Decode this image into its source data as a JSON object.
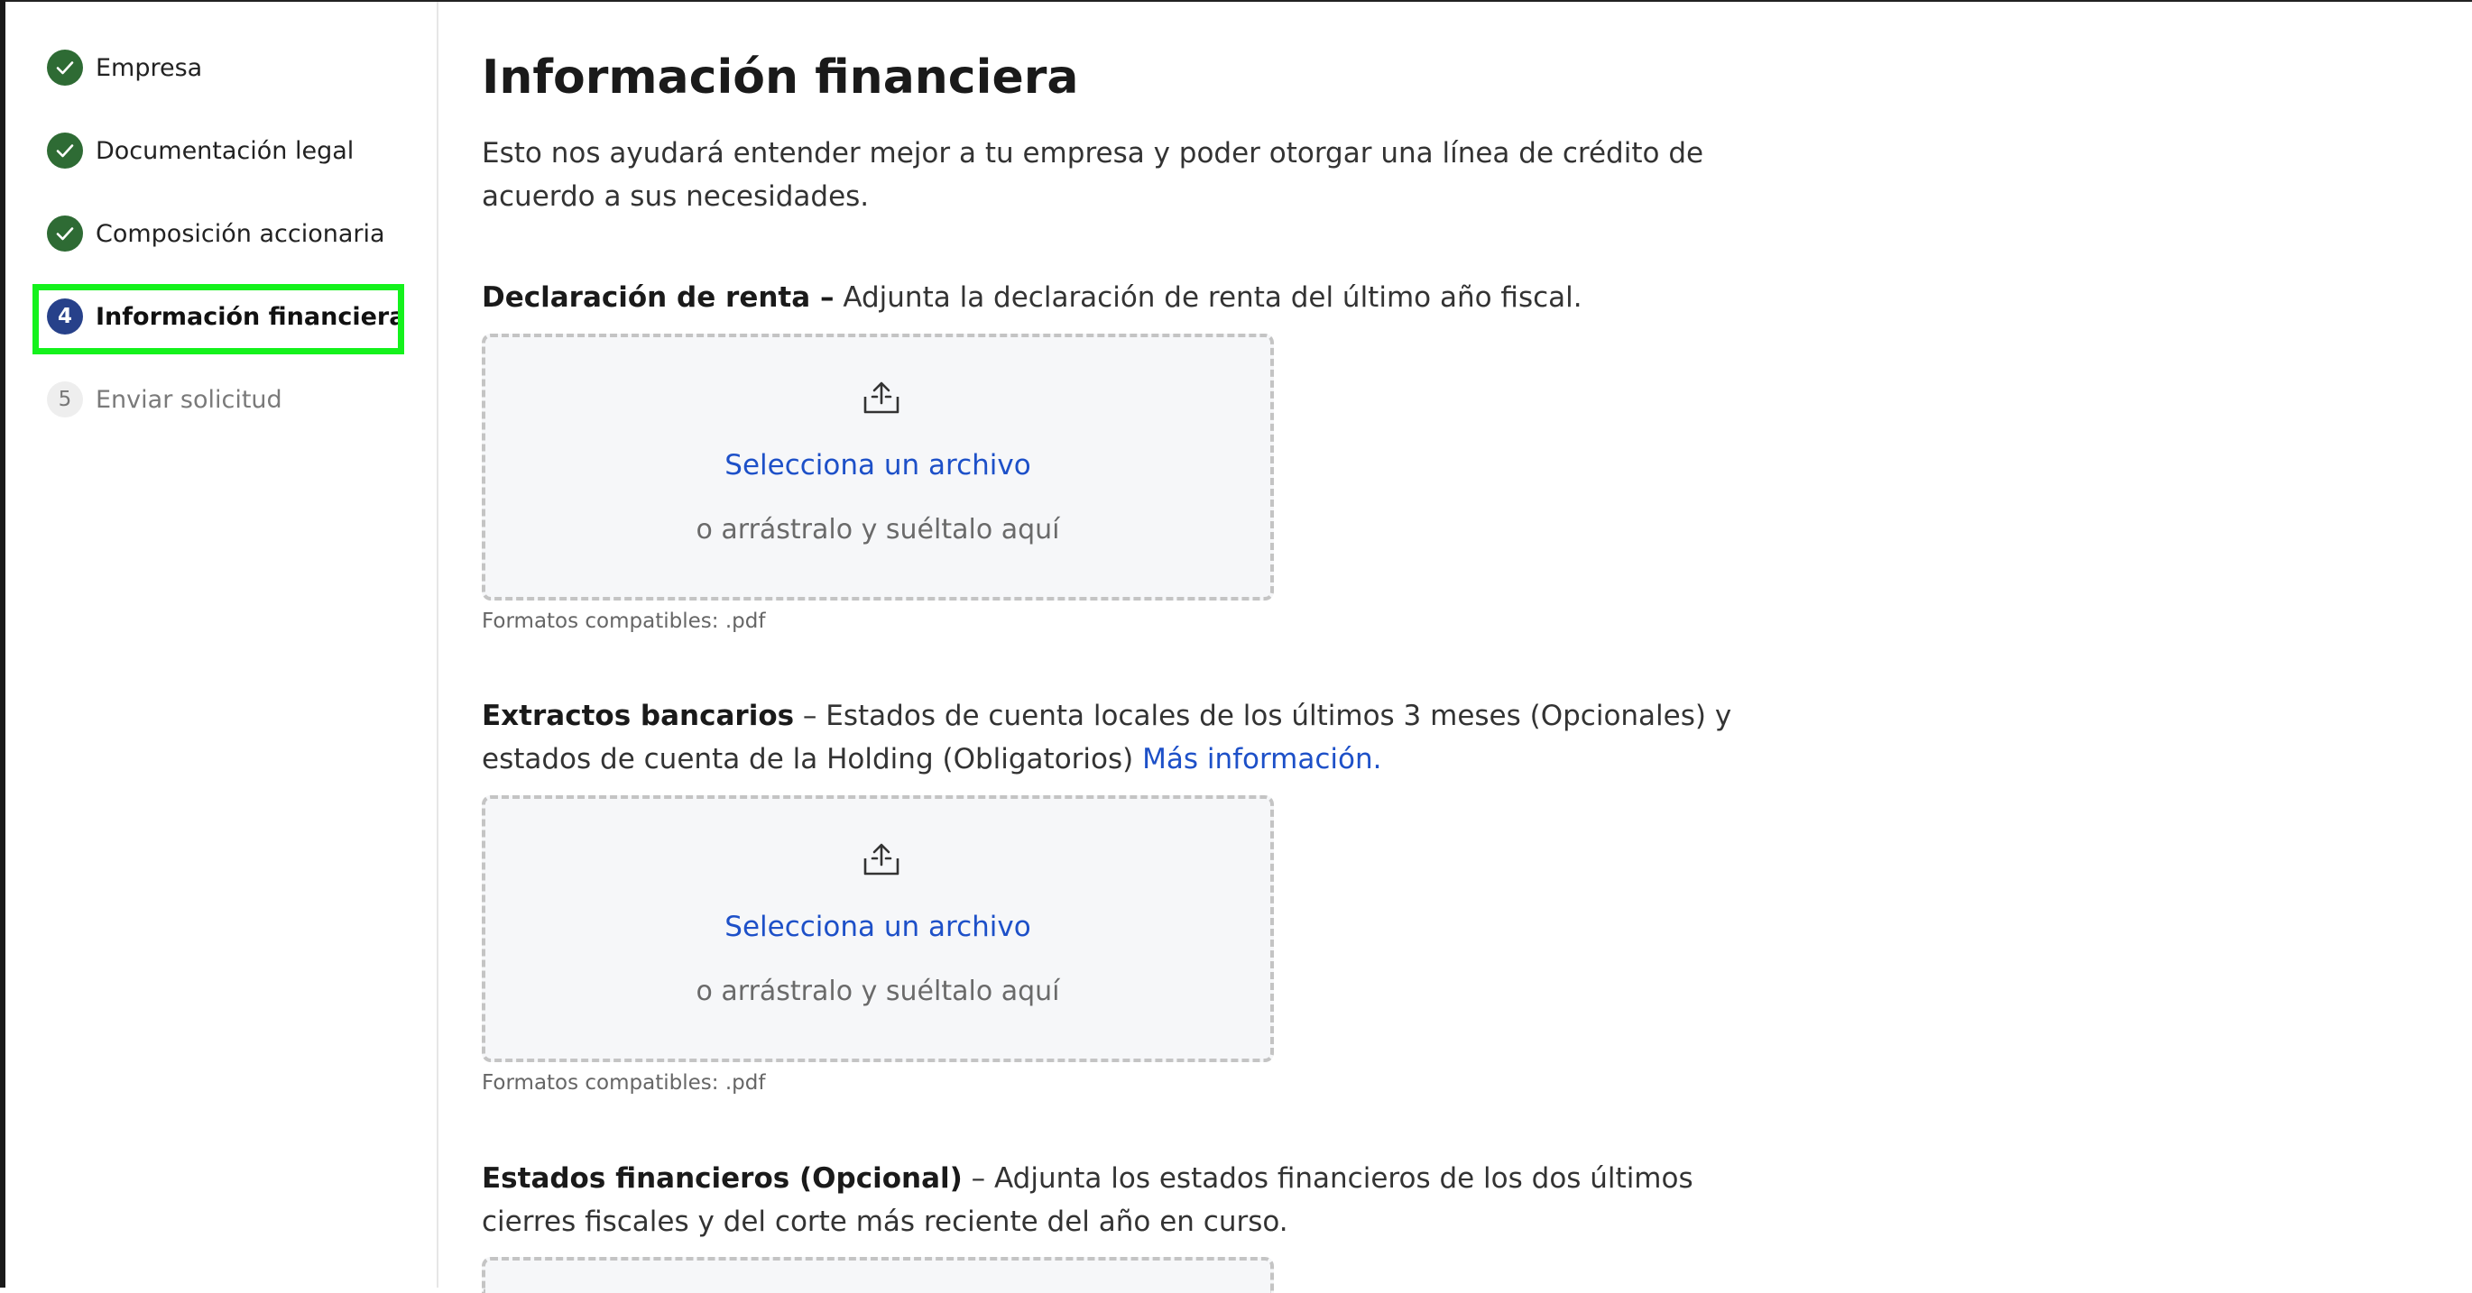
{
  "sidebar": {
    "steps": [
      {
        "number": "1",
        "label": "Empresa",
        "state": "done"
      },
      {
        "number": "2",
        "label": "Documentación legal",
        "state": "done"
      },
      {
        "number": "3",
        "label": "Composición accionaria",
        "state": "done"
      },
      {
        "number": "4",
        "label": "Información financiera",
        "state": "current"
      },
      {
        "number": "5",
        "label": "Enviar solicitud",
        "state": "pending"
      }
    ],
    "highlight_color": "#14f21c"
  },
  "main": {
    "title": "Información financiera",
    "lead": "Esto nos ayudará entender mejor a tu empresa y poder otorgar una línea de crédito de acuerdo a sus necesidades.",
    "sections": [
      {
        "heading": "Declaración de renta –",
        "description": " Adjunta la declaración de renta del último año fiscal.",
        "upload": {
          "select_label": "Selecciona un archivo",
          "drag_hint": "o arrástralo y suéltalo aquí",
          "formats": "Formatos compatibles: .pdf"
        }
      },
      {
        "heading": "Extractos bancarios",
        "description": " – Estados de cuenta locales de los últimos 3 meses (Opcionales) y estados de cuenta de la Holding (Obligatorios) ",
        "link": "Más información.",
        "upload": {
          "select_label": "Selecciona un archivo",
          "drag_hint": "o arrástralo y suéltalo aquí",
          "formats": "Formatos compatibles: .pdf"
        }
      },
      {
        "heading": "Estados financieros (Opcional)",
        "description": " – Adjunta los estados financieros de los dos últimos cierres fiscales y del corte más reciente del año en curso."
      }
    ]
  },
  "colors": {
    "done": "#2e6b34",
    "current": "#27418a",
    "link": "#1d50c8"
  }
}
